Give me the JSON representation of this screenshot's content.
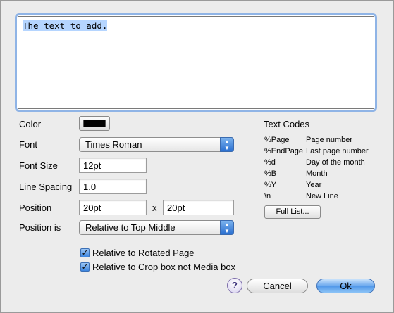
{
  "text_area": {
    "value": "The text to add."
  },
  "color": {
    "label": "Color",
    "value": "#000000"
  },
  "font": {
    "label": "Font",
    "selected": "Times Roman"
  },
  "font_size": {
    "label": "Font Size",
    "value": "12pt"
  },
  "line_spacing": {
    "label": "Line Spacing",
    "value": "1.0"
  },
  "position": {
    "label": "Position",
    "x": "20pt",
    "separator": "x",
    "y": "20pt"
  },
  "position_is": {
    "label": "Position is",
    "selected": "Relative to Top Middle"
  },
  "checkboxes": [
    {
      "label": "Relative to Rotated Page",
      "checked": true
    },
    {
      "label": "Relative to Crop box not Media box",
      "checked": true
    }
  ],
  "text_codes": {
    "title": "Text Codes",
    "items": [
      {
        "code": "%Page",
        "desc": "Page number"
      },
      {
        "code": "%EndPage",
        "desc": "Last page number"
      },
      {
        "code": "%d",
        "desc": "Day of the month"
      },
      {
        "code": "%B",
        "desc": "Month"
      },
      {
        "code": "%Y",
        "desc": "Year"
      },
      {
        "code": "\\n",
        "desc": "New Line"
      }
    ],
    "full_list_label": "Full List..."
  },
  "buttons": {
    "help": "?",
    "cancel": "Cancel",
    "ok": "Ok"
  }
}
